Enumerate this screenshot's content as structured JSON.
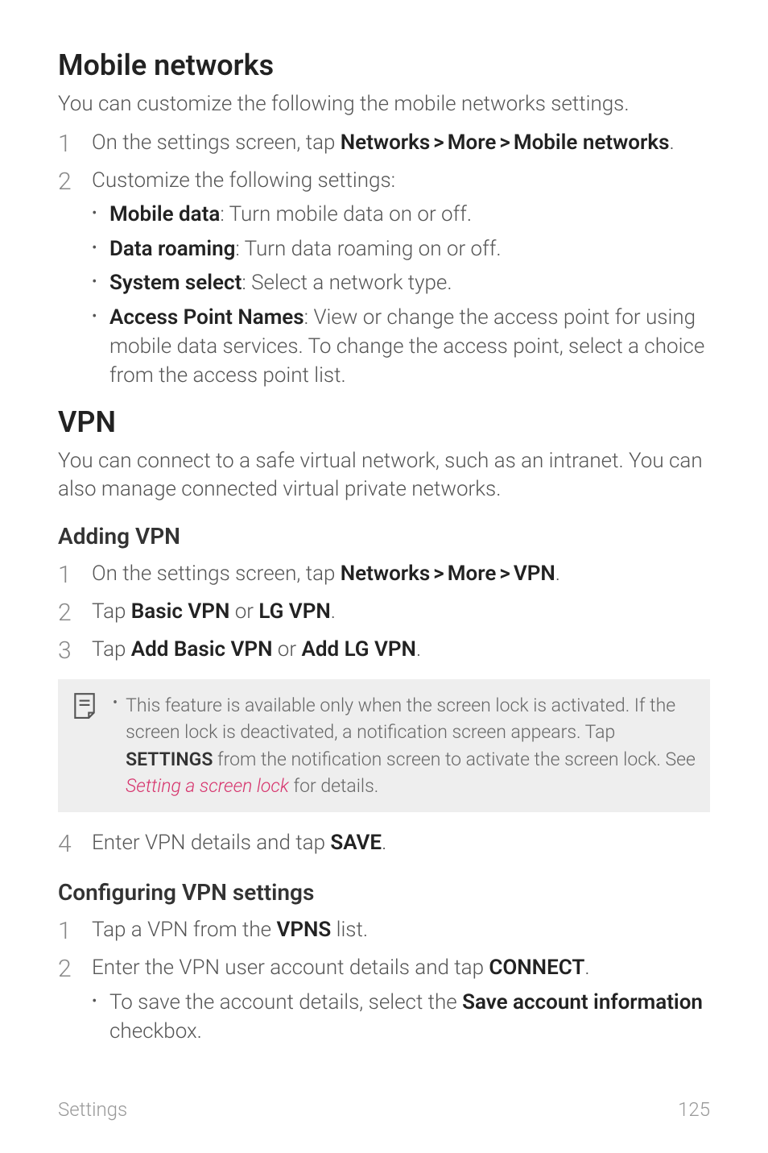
{
  "section_mobile_networks": {
    "title": "Mobile networks",
    "lead": "You can customize the following the mobile networks settings.",
    "step1_pre": "On the settings screen, tap ",
    "path": {
      "a": "Networks",
      "b": "More",
      "c": "Mobile networks"
    },
    "step1_post": ".",
    "step2": "Customize the following settings:",
    "bullets": {
      "mobile_data": {
        "label": "Mobile data",
        "desc": ": Turn mobile data on or off."
      },
      "data_roaming": {
        "label": "Data roaming",
        "desc": ": Turn data roaming on or off."
      },
      "system_select": {
        "label": "System select",
        "desc": ": Select a network type."
      },
      "apn": {
        "label": "Access Point Names",
        "desc": ": View or change the access point for using mobile data services. To change the access point, select a choice from the access point list."
      }
    }
  },
  "section_vpn": {
    "title": "VPN",
    "lead": "You can connect to a safe virtual network, such as an intranet. You can also manage connected virtual private networks.",
    "adding": {
      "title": "Adding VPN",
      "step1_pre": "On the settings screen, tap ",
      "path": {
        "a": "Networks",
        "b": "More",
        "c": "VPN"
      },
      "step1_post": ".",
      "step2_pre": "Tap ",
      "step2_a": "Basic VPN",
      "step2_or": " or ",
      "step2_b": "LG VPN",
      "step2_post": ".",
      "step3_pre": "Tap ",
      "step3_a": "Add Basic VPN",
      "step3_or": " or ",
      "step3_b": "Add LG VPN",
      "step3_post": ".",
      "note": {
        "pre": "This feature is available only when the screen lock is activated. If the screen lock is deactivated, a notification screen appears. Tap ",
        "bold": "SETTINGS",
        "mid": " from the notification screen to activate the screen lock. See ",
        "link": "Setting a screen lock",
        "post": " for details."
      },
      "step4_pre": "Enter VPN details and tap ",
      "step4_b": "SAVE",
      "step4_post": "."
    },
    "configuring": {
      "title": "Configuring VPN settings",
      "step1_pre": "Tap a VPN from the ",
      "step1_b": "VPNS",
      "step1_post": " list.",
      "step2_pre": "Enter the VPN user account details and tap ",
      "step2_b": "CONNECT",
      "step2_post": ".",
      "bullet_pre": "To save the account details, select the ",
      "bullet_b": "Save account information",
      "bullet_post": " checkbox."
    }
  },
  "footer": {
    "section": "Settings",
    "page": "125"
  },
  "gt": ">"
}
